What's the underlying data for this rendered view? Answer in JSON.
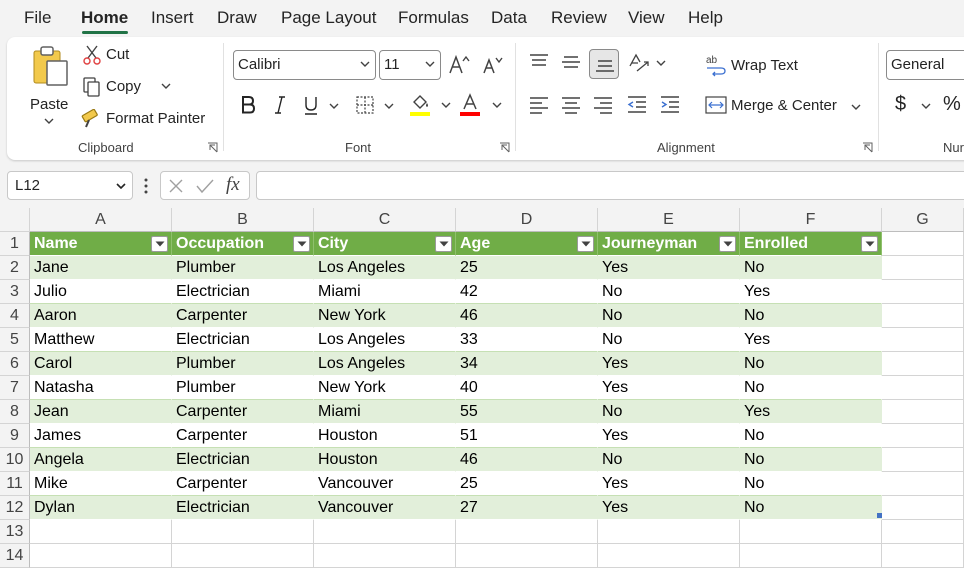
{
  "menu": {
    "tabs": [
      {
        "label": "File"
      },
      {
        "label": "Home"
      },
      {
        "label": "Insert"
      },
      {
        "label": "Draw"
      },
      {
        "label": "Page Layout"
      },
      {
        "label": "Formulas"
      },
      {
        "label": "Data"
      },
      {
        "label": "Review"
      },
      {
        "label": "View"
      },
      {
        "label": "Help"
      }
    ],
    "active_tab": "Home"
  },
  "ribbon": {
    "clipboard": {
      "paste_label": "Paste",
      "cut_label": "Cut",
      "copy_label": "Copy",
      "format_painter_label": "Format Painter",
      "group_label": "Clipboard"
    },
    "font": {
      "font_name": "Calibri",
      "font_size": "11",
      "group_label": "Font",
      "font_color": "#ff0000",
      "fill_color": "#ffff00",
      "bold_icon": "bold-icon",
      "italic_icon": "italic-icon",
      "underline_icon": "underline-icon"
    },
    "alignment": {
      "wrap_text_label": "Wrap Text",
      "merge_center_label": "Merge & Center",
      "group_label": "Alignment"
    },
    "number": {
      "format_value": "General",
      "currency_symbol": "$",
      "percent_symbol": "%",
      "group_label": "Nur"
    }
  },
  "formula_bar": {
    "name_box": "L12",
    "fx_label": "fx",
    "formula": ""
  },
  "sheet": {
    "columns": [
      "A",
      "B",
      "C",
      "D",
      "E",
      "F",
      "G"
    ],
    "rows": [
      "1",
      "2",
      "3",
      "4",
      "5",
      "6",
      "7",
      "8",
      "9",
      "10",
      "11",
      "12",
      "13",
      "14"
    ],
    "table": {
      "headers": [
        "Name",
        "Occupation",
        "City",
        "Age",
        "Journeyman",
        "Enrolled"
      ],
      "rows": [
        [
          "Jane",
          "Plumber",
          "Los Angeles",
          "25",
          "Yes",
          "No"
        ],
        [
          "Julio",
          "Electrician",
          "Miami",
          "42",
          "No",
          "Yes"
        ],
        [
          "Aaron",
          "Carpenter",
          "New York",
          "46",
          "No",
          "No"
        ],
        [
          "Matthew",
          "Electrician",
          "Los Angeles",
          "33",
          "No",
          "Yes"
        ],
        [
          "Carol",
          "Plumber",
          "Los Angeles",
          "34",
          "Yes",
          "No"
        ],
        [
          "Natasha",
          "Plumber",
          "New York",
          "40",
          "Yes",
          "No"
        ],
        [
          "Jean",
          "Carpenter",
          "Miami",
          "55",
          "No",
          "Yes"
        ],
        [
          "James",
          "Carpenter",
          "Houston",
          "51",
          "Yes",
          "No"
        ],
        [
          "Angela",
          "Electrician",
          "Houston",
          "46",
          "No",
          "No"
        ],
        [
          "Mike",
          "Carpenter",
          "Vancouver",
          "25",
          "Yes",
          "No"
        ],
        [
          "Dylan",
          "Electrician",
          "Vancouver",
          "27",
          "Yes",
          "No"
        ]
      ]
    },
    "colors": {
      "header_fill": "#70ad47",
      "band_fill": "#e2efda",
      "accent": "#217346"
    }
  }
}
